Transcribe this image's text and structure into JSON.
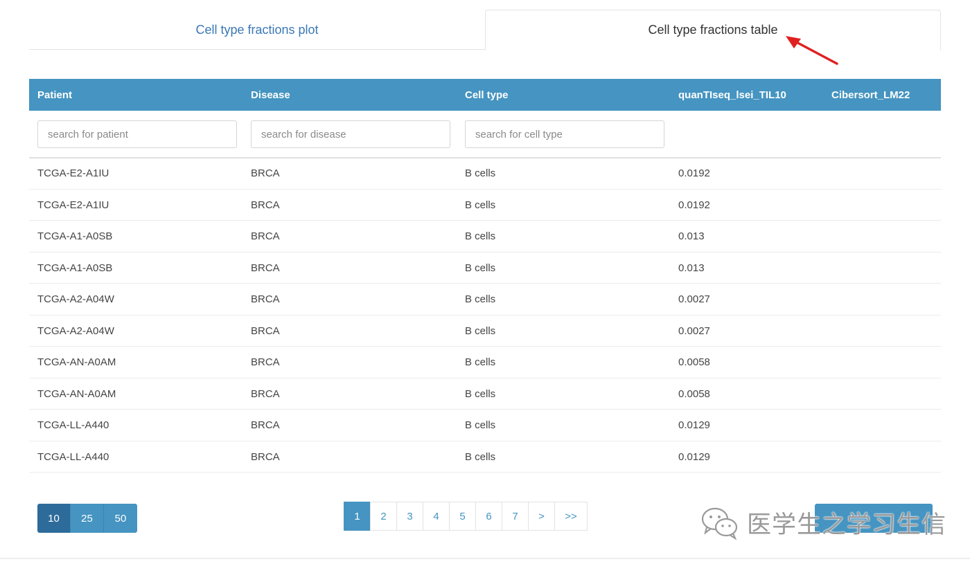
{
  "tabs": [
    {
      "label": "Cell type fractions plot",
      "active": false
    },
    {
      "label": "Cell type fractions table",
      "active": true
    }
  ],
  "table": {
    "columns": [
      "Patient",
      "Disease",
      "Cell type",
      "quanTIseq_lsei_TIL10",
      "Cibersort_LM22"
    ],
    "filters": {
      "patient_placeholder": "search for patient",
      "disease_placeholder": "search for disease",
      "celltype_placeholder": "search for cell type"
    },
    "rows": [
      [
        "TCGA-E2-A1IU",
        "BRCA",
        "B cells",
        "0.0192",
        ""
      ],
      [
        "TCGA-E2-A1IU",
        "BRCA",
        "B cells",
        "0.0192",
        ""
      ],
      [
        "TCGA-A1-A0SB",
        "BRCA",
        "B cells",
        "0.013",
        ""
      ],
      [
        "TCGA-A1-A0SB",
        "BRCA",
        "B cells",
        "0.013",
        ""
      ],
      [
        "TCGA-A2-A04W",
        "BRCA",
        "B cells",
        "0.0027",
        ""
      ],
      [
        "TCGA-A2-A04W",
        "BRCA",
        "B cells",
        "0.0027",
        ""
      ],
      [
        "TCGA-AN-A0AM",
        "BRCA",
        "B cells",
        "0.0058",
        ""
      ],
      [
        "TCGA-AN-A0AM",
        "BRCA",
        "B cells",
        "0.0058",
        ""
      ],
      [
        "TCGA-LL-A440",
        "BRCA",
        "B cells",
        "0.0129",
        ""
      ],
      [
        "TCGA-LL-A440",
        "BRCA",
        "B cells",
        "0.0129",
        ""
      ]
    ]
  },
  "page_length": {
    "options": [
      "10",
      "25",
      "50"
    ],
    "selected": "10"
  },
  "pagination": {
    "pages": [
      "1",
      "2",
      "3",
      "4",
      "5",
      "6",
      "7"
    ],
    "current": "1",
    "next": ">",
    "last": ">>"
  },
  "watermark": {
    "text": "医学生之学习生信",
    "icon": "wechat-icon"
  },
  "colors": {
    "header": "#4594c1",
    "accent_dark": "#2d6b9a",
    "link": "#3a78b5",
    "arrow": "#e02020"
  }
}
